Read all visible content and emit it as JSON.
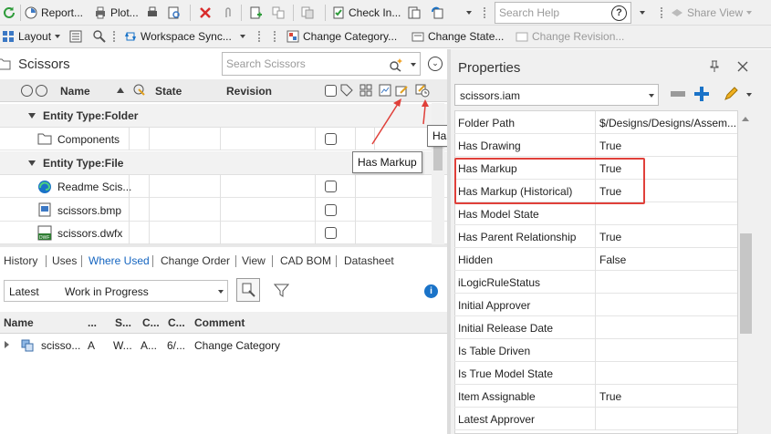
{
  "toolbar1": {
    "refresh_icon": "refresh-icon",
    "report_label": "Report...",
    "plot_label": "Plot...",
    "check_in_label": "Check In...",
    "search_help_placeholder": "Search Help",
    "share_view_label": "Share View"
  },
  "toolbar2": {
    "layout_label": "Layout",
    "workspace_sync_label": "Workspace Sync...",
    "change_category_label": "Change Category...",
    "change_state_label": "Change State...",
    "change_revision_label": "Change Revision..."
  },
  "left_panel": {
    "title": "Scissors",
    "search_placeholder": "Search Scissors",
    "columns": {
      "name": "Name",
      "state": "State",
      "revision": "Revision"
    },
    "groups": [
      {
        "label": "Entity Type:Folder",
        "rows": [
          {
            "name": "Components"
          }
        ]
      },
      {
        "label": "Entity Type:File",
        "rows": [
          {
            "name": "Readme Scis..."
          },
          {
            "name": "scissors.bmp"
          },
          {
            "name": "scissors.dwfx"
          }
        ]
      }
    ],
    "tooltip_has_markup": "Has Markup",
    "tooltip_has_markup_historical": "Has Markup (Historical)"
  },
  "bottom_panel": {
    "tabs": [
      "History",
      "Uses",
      "Where Used",
      "Change Order",
      "View",
      "CAD BOM",
      "Datasheet"
    ],
    "active_tab": "Where Used",
    "filter_left": "Latest",
    "filter_right": "Work in Progress",
    "columns": [
      "Name",
      "...",
      "S...",
      "C...",
      "C...",
      "Comment"
    ],
    "rows": [
      {
        "name": "scisso...",
        "c1": "A",
        "c2": "W...",
        "c3": "A...",
        "c4": "6/...",
        "comment": "Change Category"
      }
    ]
  },
  "properties": {
    "title": "Properties",
    "selector_value": "scissors.iam",
    "rows": [
      {
        "key": "Folder Path",
        "value": "$/Designs/Designs/Assem..."
      },
      {
        "key": "Has Drawing",
        "value": "True"
      },
      {
        "key": "Has Markup",
        "value": "True"
      },
      {
        "key": "Has Markup (Historical)",
        "value": "True"
      },
      {
        "key": "Has Model State",
        "value": ""
      },
      {
        "key": "Has Parent Relationship",
        "value": "True"
      },
      {
        "key": "Hidden",
        "value": "False"
      },
      {
        "key": "iLogicRuleStatus",
        "value": ""
      },
      {
        "key": "Initial Approver",
        "value": ""
      },
      {
        "key": "Initial Release Date",
        "value": ""
      },
      {
        "key": "Is Table Driven",
        "value": ""
      },
      {
        "key": "Is True Model State",
        "value": ""
      },
      {
        "key": "Item Assignable",
        "value": "True"
      },
      {
        "key": "Latest Approver",
        "value": ""
      }
    ]
  },
  "colors": {
    "accent_blue": "#1a73c8",
    "annotation_red": "#e0403a",
    "link_blue": "#1565c0"
  }
}
